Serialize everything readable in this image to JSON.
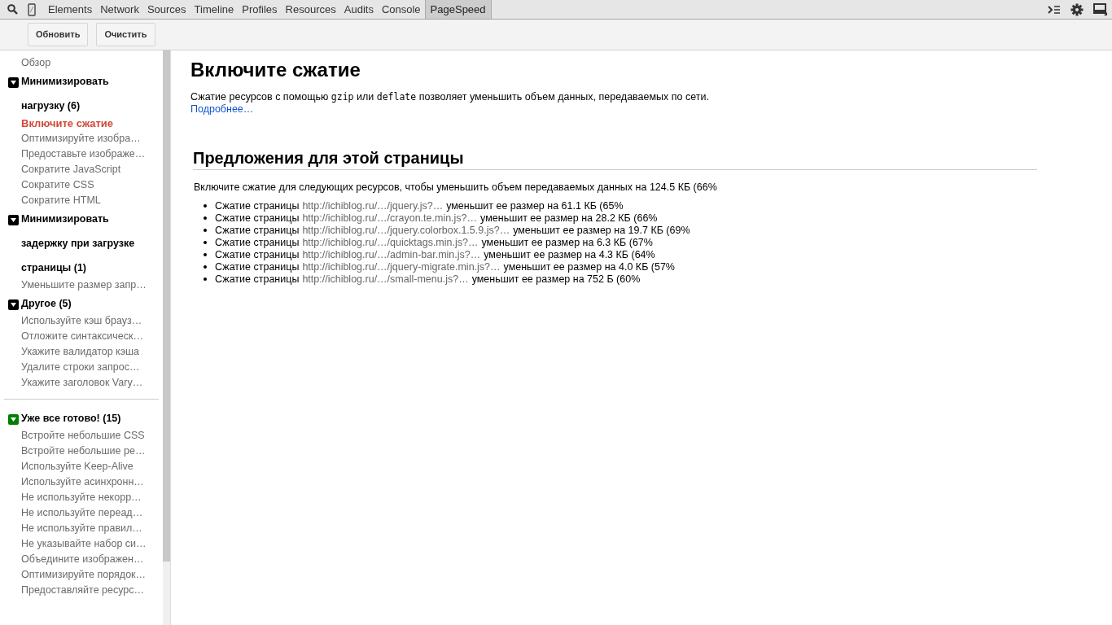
{
  "tabs": [
    {
      "label": "Elements",
      "selected": false
    },
    {
      "label": "Network",
      "selected": false
    },
    {
      "label": "Sources",
      "selected": false
    },
    {
      "label": "Timeline",
      "selected": false
    },
    {
      "label": "Profiles",
      "selected": false
    },
    {
      "label": "Resources",
      "selected": false
    },
    {
      "label": "Audits",
      "selected": false
    },
    {
      "label": "Console",
      "selected": false
    },
    {
      "label": "PageSpeed",
      "selected": true
    }
  ],
  "toolbar": {
    "buttons": [
      "Обновить",
      "Очистить"
    ]
  },
  "sidebar": {
    "overview": {
      "label": "Обзор",
      "selected": false
    },
    "groups": [
      {
        "title": "Минимизировать нагрузку (6)",
        "color": "#000000",
        "expanded": true,
        "items": [
          {
            "label": "Включите сжатие",
            "selected": true
          },
          {
            "label": "Оптимизируйте изобра…",
            "selected": false
          },
          {
            "label": "Предоставьте изображе…",
            "selected": false
          },
          {
            "label": "Сократите JavaScript",
            "selected": false
          },
          {
            "label": "Сократите CSS",
            "selected": false
          },
          {
            "label": "Сократите HTML",
            "selected": false
          }
        ]
      },
      {
        "title": "Минимизировать задержку при загрузке страницы (1)",
        "color": "#000000",
        "expanded": true,
        "items": [
          {
            "label": "Уменьшите размер запр…",
            "selected": false
          }
        ]
      },
      {
        "title": "Другое (5)",
        "color": "#000000",
        "expanded": true,
        "items": [
          {
            "label": "Используйте кэш брауз…",
            "selected": false
          },
          {
            "label": "Отложите синтаксическ…",
            "selected": false
          },
          {
            "label": "Укажите валидатор кэша",
            "selected": false
          },
          {
            "label": "Удалите строки запрос…",
            "selected": false
          },
          {
            "label": "Укажите заголовок Vary…",
            "selected": false
          }
        ]
      },
      {
        "title": "Уже все готово! (15)",
        "color": "#008000",
        "expanded": true,
        "divider_before": true,
        "items": [
          {
            "label": "Встройте небольшие CSS",
            "selected": false
          },
          {
            "label": "Встройте небольшие ре…",
            "selected": false
          },
          {
            "label": "Используйте Keep-Alive",
            "selected": false
          },
          {
            "label": "Используйте асинхронн…",
            "selected": false
          },
          {
            "label": "Не используйте некорр…",
            "selected": false
          },
          {
            "label": "Не используйте переад…",
            "selected": false
          },
          {
            "label": "Не используйте правил…",
            "selected": false
          },
          {
            "label": "Не указывайте набор си…",
            "selected": false
          },
          {
            "label": "Объедините изображен…",
            "selected": false
          },
          {
            "label": "Оптимизируйте порядок…",
            "selected": false
          },
          {
            "label": "Предоставляйте ресурс…",
            "selected": false
          }
        ]
      }
    ]
  },
  "main": {
    "title": "Включите сжатие",
    "description": [
      {
        "kind": "text",
        "text": "Сжатие ресурсов с помощью "
      },
      {
        "kind": "code",
        "text": "gzip"
      },
      {
        "kind": "text",
        "text": " или "
      },
      {
        "kind": "code",
        "text": "deflate"
      },
      {
        "kind": "text",
        "text": " позволяет уменьшить объем данных, передаваемых по сети."
      }
    ],
    "link": "Подробнее…",
    "section_title": "Предложения для этой страницы",
    "summary": "Включите сжатие для следующих ресурсов, чтобы уменьшить объем передаваемых данных на 124.5 КБ (66%",
    "resources": [
      {
        "prefix": "Сжатие страницы",
        "url": "http://ichiblog.ru/…/jquery.js?…",
        "suffix": "уменьшит ее размер на 61.1 КБ (65%"
      },
      {
        "prefix": "Сжатие страницы",
        "url": "http://ichiblog.ru/…/crayon.te.min.js?…",
        "suffix": "уменьшит ее размер на 28.2 КБ (66%"
      },
      {
        "prefix": "Сжатие страницы",
        "url": "http://ichiblog.ru/…/jquery.colorbox.1.5.9.js?…",
        "suffix": "уменьшит ее размер на 19.7 КБ (69%"
      },
      {
        "prefix": "Сжатие страницы",
        "url": "http://ichiblog.ru/…/quicktags.min.js?…",
        "suffix": "уменьшит ее размер на 6.3 КБ (67%"
      },
      {
        "prefix": "Сжатие страницы",
        "url": "http://ichiblog.ru/…/admin-bar.min.js?…",
        "suffix": "уменьшит ее размер на 4.3 КБ (64%"
      },
      {
        "prefix": "Сжатие страницы",
        "url": "http://ichiblog.ru/…/jquery-migrate.min.js?…",
        "suffix": "уменьшит ее размер на 4.0 КБ (57%"
      },
      {
        "prefix": "Сжатие страницы",
        "url": "http://ichiblog.ru/…/small-menu.js?…",
        "suffix": "уменьшит ее размер на 752 Б (60%"
      }
    ]
  }
}
